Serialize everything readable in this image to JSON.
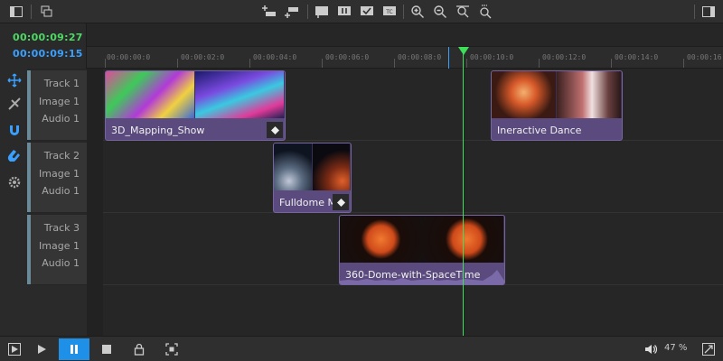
{
  "timecodes": {
    "current": "00:00:09:27",
    "marker": "00:00:09:15"
  },
  "ruler": {
    "ticks": [
      "00:00:00:0",
      "00:00:02:0",
      "00:00:04:0",
      "00:00:06:0",
      "00:00:08:0",
      "00:00:10:0",
      "00:00:12:0",
      "00:00:14:0",
      "00:00:16"
    ]
  },
  "tracks": [
    {
      "title": "Track 1",
      "image": "Image 1",
      "audio": "Audio 1"
    },
    {
      "title": "Track 2",
      "image": "Image 1",
      "audio": "Audio 1"
    },
    {
      "title": "Track 3",
      "image": "Image 1",
      "audio": "Audio 1"
    }
  ],
  "clips": {
    "c1": {
      "name": "3D_Mapping_Show"
    },
    "c2": {
      "name": "Ineractive Dance"
    },
    "c3": {
      "name": "Fulldome M"
    },
    "c4": {
      "name": "360-Dome-with-SpaceTime"
    }
  },
  "bottom": {
    "zoom": "47 %"
  },
  "colors": {
    "accent": "#1e90e8",
    "playhead": "#3ee05a",
    "clip": "#5b4a7e",
    "timecode_green": "#4cd964",
    "timecode_blue": "#3aa0ff"
  }
}
